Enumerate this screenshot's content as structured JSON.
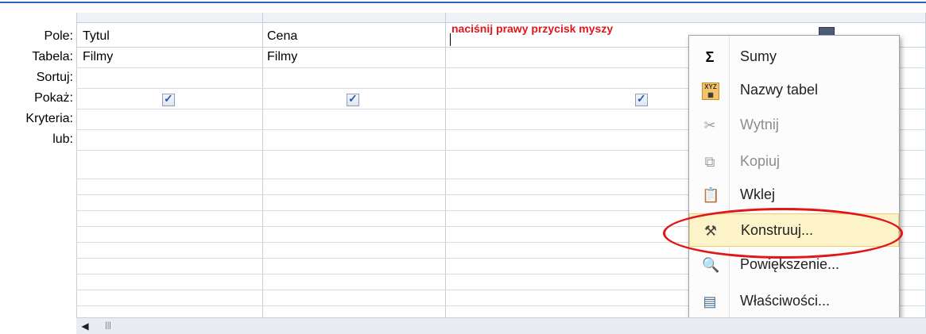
{
  "row_labels": [
    "Pole:",
    "Tabela:",
    "Sortuj:",
    "Pokaż:",
    "Kryteria:",
    "lub:"
  ],
  "columns": [
    {
      "field": "Tytul",
      "table": "Filmy",
      "show": true
    },
    {
      "field": "Cena",
      "table": "Filmy",
      "show": true
    },
    {
      "field": "",
      "table": "",
      "show": true
    }
  ],
  "annotation": "naciśnij prawy przycisk myszy",
  "context_menu": {
    "items": [
      {
        "label": "Sumy",
        "icon": "sigma-icon",
        "enabled": true
      },
      {
        "label": "Nazwy tabel",
        "icon": "table-names-icon",
        "enabled": true
      },
      {
        "label": "Wytnij",
        "icon": "scissors-icon",
        "enabled": false
      },
      {
        "label": "Kopiuj",
        "icon": "copy-icon",
        "enabled": false
      },
      {
        "label": "Wklej",
        "icon": "paste-icon",
        "enabled": true
      },
      {
        "label": "Konstruuj...",
        "icon": "build-wand-icon",
        "enabled": true,
        "highlighted": true
      },
      {
        "label": "Powiększenie...",
        "icon": "zoom-icon",
        "enabled": true
      },
      {
        "label": "Właściwości...",
        "icon": "properties-icon",
        "enabled": true
      }
    ]
  },
  "colors": {
    "accent_annotation": "#e0161a",
    "highlight_bg": "#fdf3c9",
    "grid_line": "#c8cdd6"
  }
}
